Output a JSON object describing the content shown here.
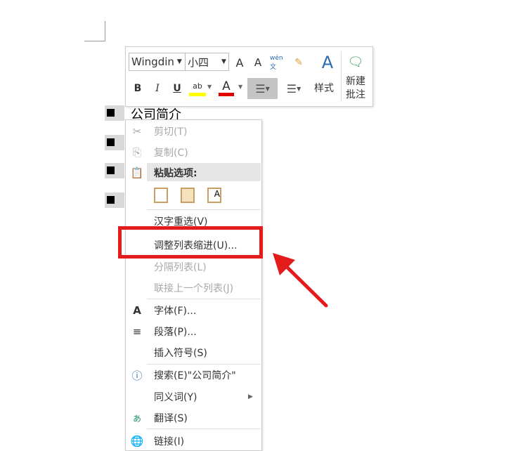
{
  "toolbar": {
    "font": "Wingdin",
    "size": "小四",
    "grow_font": "A",
    "shrink_font": "A",
    "phonetic": "wén文",
    "bold": "B",
    "italic": "I",
    "underline": "U",
    "highlight": "ab",
    "font_color": "A",
    "styles": "样式",
    "new_comment_1": "新建",
    "new_comment_2": "批注"
  },
  "document": {
    "text": "公司简介"
  },
  "menu": {
    "cut": "剪切(T)",
    "copy": "复制(C)",
    "paste_header": "粘贴选项:",
    "reconvert": "汉字重选(V)",
    "adjust_indent": "调整列表缩进(U)...",
    "separate_list": "分隔列表(L)",
    "join_list": "联接上一个列表(J)",
    "font": "字体(F)...",
    "paragraph": "段落(P)...",
    "insert_symbol": "插入符号(S)",
    "search": "搜索(E)\"公司简介\"",
    "synonyms": "同义词(Y)",
    "translate": "翻译(S)",
    "link": "链接(I)"
  },
  "colors": {
    "highlight": "#e41b1b"
  }
}
